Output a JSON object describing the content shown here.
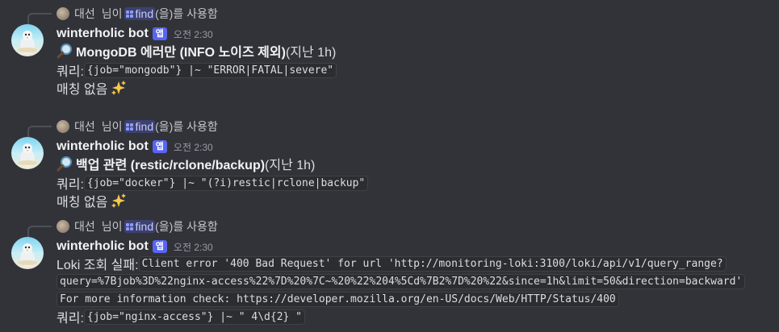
{
  "messages": [
    {
      "reply": {
        "user": "대선",
        "user_suffix": "님이",
        "command": "find",
        "tail": "(을)를 사용함"
      },
      "bot": {
        "name": "winterholic bot",
        "badge": "앱",
        "time": "오전 2:30"
      },
      "title_bold": "MongoDB 에러만 (INFO 노이즈 제외)",
      "title_rest": " (지난 1h)",
      "query_label": "쿼리: ",
      "query": "{job=\"mongodb\"} |~ \"ERROR|FATAL|severe\"",
      "result": "매칭 없음"
    },
    {
      "reply": {
        "user": "대선",
        "user_suffix": "님이",
        "command": "find",
        "tail": "(을)를 사용함"
      },
      "bot": {
        "name": "winterholic bot",
        "badge": "앱",
        "time": "오전 2:30"
      },
      "title_bold": "백업 관련 (restic/rclone/backup)",
      "title_rest": " (지난 1h)",
      "query_label": "쿼리: ",
      "query": "{job=\"docker\"} |~ \"(?i)restic|rclone|backup\"",
      "result": "매칭 없음"
    },
    {
      "reply": {
        "user": "대선",
        "user_suffix": "님이",
        "command": "find",
        "tail": "(을)를 사용함"
      },
      "bot": {
        "name": "winterholic bot",
        "badge": "앱",
        "time": "오전 2:30"
      },
      "error_label": "Loki 조회 실패: ",
      "error_line1": "Client error '400 Bad Request' for url 'http://monitoring-loki:3100/loki/api/v1/query_range?",
      "error_line2": "query=%7Bjob%3D%22nginx-access%22%7D%20%7C~%20%22%204%5Cd%7B2%7D%20%22&since=1h&limit=50&direction=backward'",
      "error_line3": "For more information check: https://developer.mozilla.org/en-US/docs/Web/HTTP/Status/400",
      "query_label": "쿼리: ",
      "query": "{job=\"nginx-access\"} |~ \" 4\\d{2} \""
    }
  ]
}
